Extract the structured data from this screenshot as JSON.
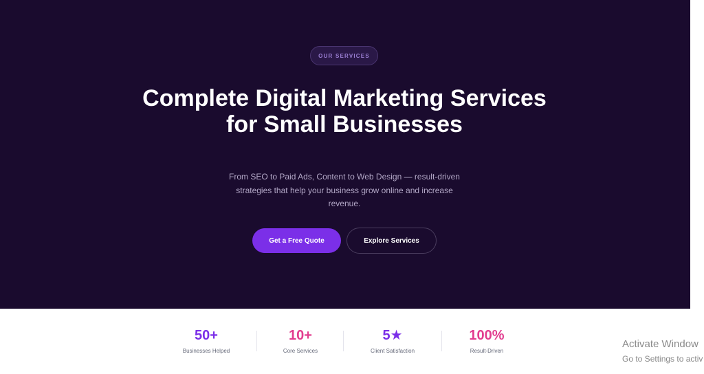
{
  "hero": {
    "badge": "OUR SERVICES",
    "headline": "Complete Digital Marketing Services for Small Businesses",
    "subtext": "From SEO to Paid Ads, Content to Web Design — result-driven strategies that help your business grow online and increase revenue.",
    "primary_button": "Get a Free Quote",
    "secondary_button": "Explore Services",
    "background_color": "#1a0b2e",
    "accent_color": "#7b2fe8"
  },
  "stats": [
    {
      "value": "50+",
      "label": "Businesses Helped",
      "color": "#7b2fe8"
    },
    {
      "value": "10+",
      "label": "Core Services",
      "color": "#e23d8f"
    },
    {
      "value": "5★",
      "label": "Client Satisfaction",
      "color": "#7b2fe8"
    },
    {
      "value": "100%",
      "label": "Result-Driven",
      "color": "#e23d8f"
    }
  ],
  "watermark": {
    "line1": "Activate Window",
    "line2": "Go to Settings to activ"
  }
}
